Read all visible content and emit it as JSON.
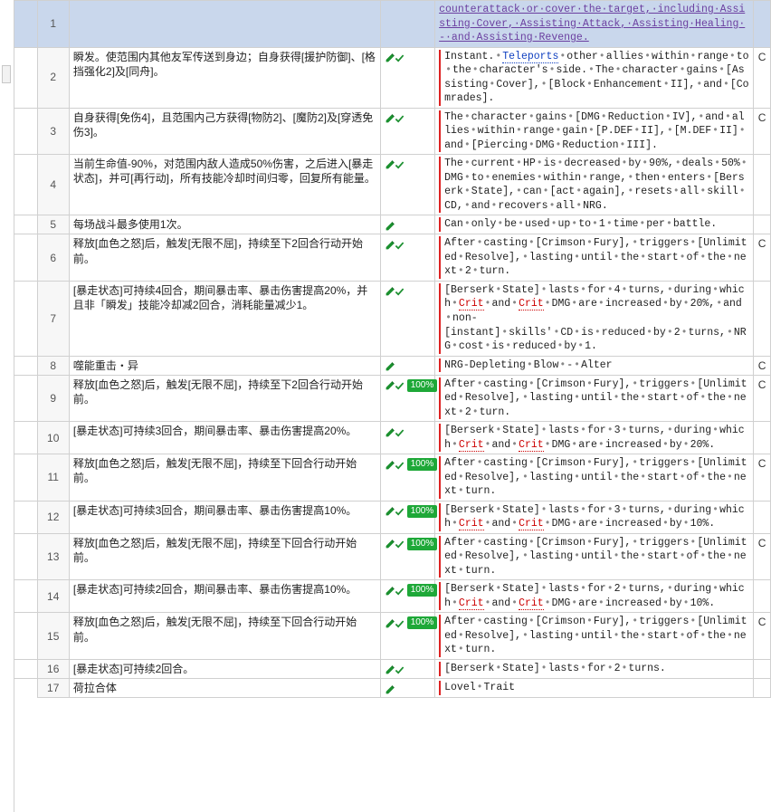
{
  "header_target": "counterattack·or·cover·the·target,·including·Assisting·Cover,·Assisting·Attack,·Assisting·Healing·-·and·Assisting·Revenge.",
  "rows": [
    {
      "n": "2",
      "src": "瞬发。使范围内其他友军传送到身边；自身获得[援护防御]、[格挡强化2]及[同舟]。",
      "tgt": "Instant.·Teleports·other·allies·within·range·to·the·character's·side.·The·character·gains·[Assisting·Cover],·[Block·Enhancement·II],·and·[Comrades].",
      "chk": true,
      "tail": "C"
    },
    {
      "n": "3",
      "src": "自身获得[免伤4]，且范围内己方获得[<sprite=2>物防2]、[<sprite=2>魔防2]及[穿透免伤3]。",
      "tgt": "The·character·gains·[DMG·Reduction·IV],·and·allies·within·range·gain·[<sprite=2>P.DEF·II],·[<sprite=2>M.DEF·II]·and·[Piercing·DMG·Reduction·III].",
      "chk": true,
      "tail": "C"
    },
    {
      "n": "4",
      "src": "当前生命值-90%，对范围内敌人造成50%伤害，之后进入[暴走状态]，并可[再行动]，所有技能冷却时间归零，回复所有能量。",
      "tgt": "The·current·HP·is·decreased·by·90%,·deals·50%·DMG·to·enemies·within·range,·then·enters·[Berserk·State],·can·[act·again],·resets·all·skill·CD,·and·recovers·all·NRG.",
      "chk": true,
      "tail": ""
    },
    {
      "n": "5",
      "src": "每场战斗最多使用1次。",
      "tgt": "Can·only·be·used·up·to·1·time·per·battle.",
      "chk": false,
      "tail": ""
    },
    {
      "n": "6",
      "src": "释放[血色之怒]后，触发[<style=C4>无限不屈</style>]，持续至下<style=red>2</style>回合行动开始前。",
      "tgt": "After·casting·[Crimson·Fury],·triggers·[<style=C4>Unlimited·Resolve</style>],·lasting·until·the·start·of·the·next·<style=red>2</style>·turn.",
      "chk": true,
      "tail": "C"
    },
    {
      "n": "7",
      "src": "[暴走状态]可持续<style=red>4</style>回合，期间暴击率、暴击伤害提高<style=red>20%</style>，并且非「瞬发」技能冷却减<style=red>2</style>回合，消耗能量减少<style=red>1</style>。",
      "tgt": "[Berserk·State]·lasts·for·<style=red>4</style>·turns,·during·which·Crit·and·Crit·DMG·are·increased·by·<style=red>20%</style>,·and·non-[instant]·skills'·CD·is·reduced·by·<style=red>2</style>·turns,·NRG·cost·is·reduced·by·<style=red>1</style>.",
      "chk": true,
      "tail": ""
    },
    {
      "n": "8",
      "src": "噬能重击・异",
      "tgt": "NRG-Depleting·Blow·-·Alter",
      "chk": false,
      "tail": "C"
    },
    {
      "n": "9",
      "src": "释放[血色之怒]后，触发[<style=C4>无限不屈</style>]，持续至下<style=red>2</style>回合行动开始前。",
      "tgt": "After·casting·[Crimson·Fury],·triggers·[<style=C4>Unlimited·Resolve</style>],·lasting·until·the·start·of·the·next·<style=red>2</style>·turn.",
      "chk": true,
      "badge": "100%",
      "tail": "C"
    },
    {
      "n": "10",
      "src": "[暴走状态]可持续<style=red>3</style>回合，期间暴击率、暴击伤害提高<style=red>20%</style>。",
      "tgt": "[Berserk·State]·lasts·for·<style=red>3</style>·turns,·during·which·Crit·and·Crit·DMG·are·increased·by·<style=red>20%</style>.",
      "chk": true,
      "tail": ""
    },
    {
      "n": "11",
      "src": "释放[血色之怒]后，触发[<style=C4>无限不屈</style>]，持续至下回合行动开始前。",
      "tgt": "After·casting·[Crimson·Fury],·triggers·[<style=C4>Unlimited·Resolve</style>],·lasting·until·the·start·of·the·next·turn.",
      "chk": true,
      "badge": "100%",
      "tail": "C"
    },
    {
      "n": "12",
      "src": "[暴走状态]可持续<style=red>3</style>回合，期间暴击率、暴击伤害提高<style=red>10%</style>。",
      "tgt": "[Berserk·State]·lasts·for·<style=red>3</style>·turns,·during·which·Crit·and·Crit·DMG·are·increased·by·<style=red>10%</style>.",
      "chk": true,
      "badge": "100%",
      "tail": ""
    },
    {
      "n": "13",
      "src": "释放[血色之怒]后，触发[<style=C4>无限不屈</style>]，持续至下回合行动开始前。",
      "tgt": "After·casting·[Crimson·Fury],·triggers·[<style=C4>Unlimited·Resolve</style>],·lasting·until·the·start·of·the·next·turn.",
      "chk": true,
      "badge": "100%",
      "tail": "C"
    },
    {
      "n": "14",
      "src": "[暴走状态]可持续<style=red>2</style>回合，期间暴击率、暴击伤害提高<style=red>10%</style>。",
      "tgt": "[Berserk·State]·lasts·for·<style=red>2</style>·turns,·during·which·Crit·and·Crit·DMG·are·increased·by·<style=red>10%</style>.",
      "chk": true,
      "badge": "100%",
      "tail": ""
    },
    {
      "n": "15",
      "src": "释放[血色之怒]后，触发[<style=C4>无限不屈</style>]，持续至下回合行动开始前。",
      "tgt": "After·casting·[Crimson·Fury],·triggers·[<style=C4>Unlimited·Resolve</style>],·lasting·until·the·start·of·the·next·turn.",
      "chk": true,
      "badge": "100%",
      "tail": "C"
    },
    {
      "n": "16",
      "src": "[暴走状态]可持续<style=red>2</style>回合。",
      "tgt": "[Berserk·State]·lasts·for·<style=red>2</style>·turns.",
      "chk": true,
      "tail": ""
    },
    {
      "n": "17",
      "src": "荷拉合体",
      "tgt": "Lovel·Trait",
      "chk": false,
      "tail": ""
    }
  ],
  "hdr_num": "1"
}
